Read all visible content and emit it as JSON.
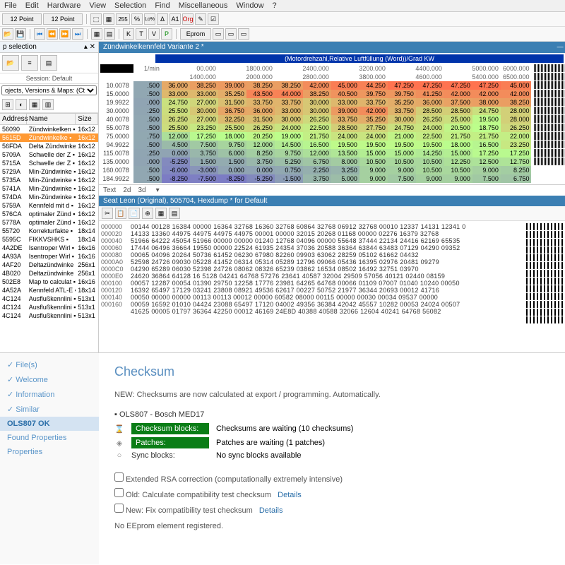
{
  "menu": [
    "File",
    "Edit",
    "Hardware",
    "View",
    "Selection",
    "Find",
    "Miscellaneous",
    "Window",
    "?"
  ],
  "toolbar_labels": {
    "font1": "12 Point",
    "font2": "12 Point",
    "eprom": "Eprom"
  },
  "sidebar": {
    "title": "p selection",
    "session": "Session: Default",
    "dropdown": "ojects, Versions & Maps:  (Ctrl+Shift+F)",
    "cols": [
      "Address",
      "Name",
      "Size"
    ],
    "rows": [
      {
        "a": "56090",
        "n": "Zündwinkelken",
        "s": "16x12"
      },
      {
        "a": "5615D",
        "n": "Zündwinkelke",
        "s": "16x12"
      },
      {
        "a": "56FDA",
        "n": "Delta Zündwinke",
        "s": "16x12"
      },
      {
        "a": "5709A",
        "n": "Schwelle der Z",
        "s": "16x12"
      },
      {
        "a": "5715A",
        "n": "Schwelle der Z",
        "s": "16x12"
      },
      {
        "a": "5729A",
        "n": "Min-Zündwinke",
        "s": "16x12"
      },
      {
        "a": "5735A",
        "n": "Min-Zündwinke",
        "s": "16x12"
      },
      {
        "a": "5741A",
        "n": "Min-Zündwinke",
        "s": "16x12"
      },
      {
        "a": "574DA",
        "n": "Min-Zündwinke",
        "s": "16x12"
      },
      {
        "a": "5759A",
        "n": "Kennfeld mit d",
        "s": "16x12"
      },
      {
        "a": "576CA",
        "n": "optimaler Zünd",
        "s": "16x12"
      },
      {
        "a": "5778A",
        "n": "optimaler Zünd",
        "s": "16x12"
      },
      {
        "a": "55720",
        "n": "Korrekturfakte",
        "s": "18x14"
      },
      {
        "a": "5595C",
        "n": "FIKKVSHKS",
        "s": "18x14"
      },
      {
        "a": "4A2DE",
        "n": "Isentroper Wirl",
        "s": "16x16"
      },
      {
        "a": "4A93A",
        "n": "Isentroper Wirl",
        "s": "16x16"
      },
      {
        "a": "4AF20",
        "n": "Deltazündwinke",
        "s": "256x1"
      },
      {
        "a": "4B020",
        "n": "Deltazündwinke",
        "s": "256x1"
      },
      {
        "a": "502E8",
        "n": "Map to calculat",
        "s": "16x16"
      },
      {
        "a": "4A52A",
        "n": "Kennfeld ATL-E",
        "s": "18x14"
      },
      {
        "a": "4C124",
        "n": "Ausflußkennlini",
        "s": "513x1"
      },
      {
        "a": "4C124",
        "n": "Ausflußkennlini",
        "s": "513x1"
      },
      {
        "a": "4C124",
        "n": "Ausflußkennlini",
        "s": "513x1"
      }
    ],
    "selected": 1
  },
  "map": {
    "title": "Zündwinkelkennfeld Variante 2 *",
    "header": "(Motordrehzahl,Relative Luftfüllung (Word))/Grad KW",
    "unit": "1/min",
    "cols_top": [
      "00.000",
      "1800.000",
      "2400.000",
      "3200.000",
      "4400.000",
      "5000.000",
      "6000.000"
    ],
    "cols_bot": [
      "1400.000",
      "2000.000",
      "2800.000",
      "3800.000",
      "4600.000",
      "5400.000",
      "6500.000"
    ],
    "rows": [
      {
        "h": "10.0078",
        "v": [
          ".500",
          "36.000",
          "38.250",
          "39.000",
          "38.250",
          "38.250",
          "42.000",
          "45.000",
          "44.250",
          "47.250",
          "47.250",
          "47.250",
          "47.250",
          "45.000"
        ]
      },
      {
        "h": "15.0000",
        "v": [
          ".500",
          "33.000",
          "33.000",
          "35.250",
          "43.500",
          "44.000",
          "38.250",
          "40.500",
          "39.750",
          "39.750",
          "41.250",
          "42.000",
          "42.000",
          "42.000"
        ]
      },
      {
        "h": "19.9922",
        "v": [
          ".000",
          "24.750",
          "27.000",
          "31.500",
          "33.750",
          "33.750",
          "30.000",
          "33.000",
          "33.750",
          "35.250",
          "36.000",
          "37.500",
          "38.000",
          "38.250"
        ]
      },
      {
        "h": "30.0000",
        "v": [
          ".250",
          "25.500",
          "30.000",
          "36.750",
          "36.000",
          "33.000",
          "30.000",
          "39.000",
          "42.000",
          "33.750",
          "28.500",
          "28.500",
          "24.750",
          "28.000"
        ]
      },
      {
        "h": "40.0078",
        "v": [
          ".500",
          "26.250",
          "27.000",
          "32.250",
          "31.500",
          "30.000",
          "26.250",
          "33.750",
          "35.250",
          "30.000",
          "26.250",
          "25.000",
          "19.500",
          "28.000"
        ]
      },
      {
        "h": "55.0078",
        "v": [
          ".500",
          "25.500",
          "23.250",
          "25.500",
          "26.250",
          "24.000",
          "22.500",
          "28.500",
          "27.750",
          "24.750",
          "24.000",
          "20.500",
          "18.750",
          "26.250"
        ]
      },
      {
        "h": "75.0000",
        "v": [
          ".750",
          "12.000",
          "17.250",
          "18.000",
          "20.250",
          "19.000",
          "21.750",
          "24.000",
          "24.000",
          "21.000",
          "22.500",
          "21.750",
          "21.750",
          "22.000"
        ]
      },
      {
        "h": "94.9922",
        "v": [
          ".500",
          "4.500",
          "7.500",
          "9.750",
          "12.000",
          "14.500",
          "16.500",
          "19.500",
          "19.500",
          "19.500",
          "19.500",
          "18.000",
          "16.500",
          "23.250"
        ]
      },
      {
        "h": "115.0078",
        "v": [
          ".250",
          "0.000",
          "3.750",
          "6.000",
          "8.250",
          "9.750",
          "12.000",
          "13.500",
          "15.000",
          "15.000",
          "14.250",
          "15.000",
          "17.250",
          "17.250"
        ]
      },
      {
        "h": "135.0000",
        "v": [
          ".000",
          "-5.250",
          "1.500",
          "1.500",
          "3.750",
          "5.250",
          "6.750",
          "8.000",
          "10.500",
          "10.500",
          "10.500",
          "12.250",
          "12.500",
          "12.750"
        ]
      },
      {
        "h": "160.0078",
        "v": [
          ".500",
          "-6.000",
          "-3.000",
          "0.000",
          "0.000",
          "0.750",
          "2.250",
          "3.250",
          "9.000",
          "9.000",
          "10.500",
          "10.500",
          "9.000",
          "8.250"
        ]
      },
      {
        "h": "184.9922",
        "v": [
          ".500",
          "-8.250",
          "-7.500",
          "-8.250",
          "-5.250",
          "-1.500",
          "3.750",
          "5.000",
          "9.000",
          "7.500",
          "9.000",
          "9.000",
          "7.500",
          "6.750"
        ]
      }
    ],
    "tabs": [
      "Text",
      "2d",
      "3d"
    ]
  },
  "hex": {
    "title": "Seat Leon (Original), 505704, Hexdump * for Default",
    "offsets": [
      "000000",
      "000020",
      "000040",
      "000060",
      "000080",
      "0000A0",
      "0000C0",
      "0000E0",
      "000100",
      "000120",
      "000140",
      "000160"
    ],
    "lines": [
      "00144 00128 16384 00000 16364 32768 16360 32768 60864 32768 06912 32768 00010 12337 14131 12341 0",
      "14133 13360 44975 44975 44975 44975 00001 00000 32015 20268 01168 00000 02276 16379 32768",
      "51966 64222 45054 51966 00000 00000 01240 12768 04096 00000 55648 37444 22134 24416 62169 65535",
      "17444 06496 36664 19550 00000 22524 61935 24354 37036 20588 36364 63844 63483 07129 04290 09352",
      "00065 04096 20264 50736 61452 06230 67980 82260 09903 63062 28259 05102 61662 04432",
      "52598 24726 09030 05228 41452 06314 05314 05289 12796 09066 05436 16395 02976 20481 09279",
      "04290 65289 06030 52398 24726 08062 08326 65239 03862 16534 08502 16492 32751 03970",
      "24620 36864 64128 16 5128 04241 64768 57276 23641 40587 32004 29509 57056 40121 02440 08159",
      "00057 12287 00054 01390 29750 12258 17776 23981 64265 64768 00066 01109 07007 01040 10240 00050",
      "16392 65497 17129 03241 23808 08921 49536 62617 00227 50752 21977 36344 20693 00012 41716",
      "00050 00000 00000 00113 00113 00012 00000 60582 08000 00115 00000 00030 00034 09537 00000",
      "00059 16592 01010 04424 23088 65497 17120 04002 49356 36384 42042 45557 10282 00053 24024 00507",
      "41625 00005 01797 36364 42250 00012 46169 24E8D 40388 40588 32066 12604 40241 64768 56082"
    ]
  },
  "nav": [
    {
      "label": "File(s)",
      "chk": true
    },
    {
      "label": "Welcome",
      "chk": true
    },
    {
      "label": "Information",
      "chk": true
    },
    {
      "label": "Similar",
      "chk": true
    },
    {
      "label": "OLS807 OK",
      "sel": true
    },
    {
      "label": "Found Properties"
    },
    {
      "label": "Properties"
    }
  ],
  "checksum": {
    "title": "Checksum",
    "new": "NEW: Checksums are now calculated at export / programming. Automatically.",
    "box": "OLS807 - Bosch MED17",
    "rows": [
      {
        "ic": "⌛",
        "label": "Checksum blocks:",
        "txt": "Checksums are waiting (10 checksums)",
        "pill": true
      },
      {
        "ic": "◈",
        "label": "Patches:",
        "txt": "Patches are waiting (1 patches)",
        "pill": true
      },
      {
        "ic": "○",
        "label": "Sync blocks:",
        "txt": "No sync blocks available",
        "pill": false
      }
    ],
    "opts": [
      "Extended RSA correction (computationally extremely intensive)",
      "Old: Calculate compatibility test checksum",
      "New: Fix compatibility test checksum"
    ],
    "details": "Details",
    "footer": "No EEprom element registered."
  },
  "chart_data": {
    "type": "heatmap",
    "title": "Zündwinkelkennfeld Variante 2",
    "xlabel": "Motordrehzahl 1/min",
    "ylabel": "Relative Luftfüllung (Word)",
    "zlabel": "Grad KW",
    "x": [
      0,
      1400,
      1800,
      2000,
      2400,
      2800,
      3200,
      3800,
      4400,
      4600,
      5000,
      5400,
      6000,
      6500
    ],
    "y": [
      10.0078,
      15.0,
      19.9922,
      30.0,
      40.0078,
      55.0078,
      75.0,
      94.9922,
      115.0078,
      135.0,
      160.0078,
      184.9922
    ],
    "z": [
      [
        0.5,
        36.0,
        38.25,
        39.0,
        38.25,
        38.25,
        42.0,
        45.0,
        44.25,
        47.25,
        47.25,
        47.25,
        47.25,
        45.0
      ],
      [
        0.5,
        33.0,
        33.0,
        35.25,
        43.5,
        44.0,
        38.25,
        40.5,
        39.75,
        39.75,
        41.25,
        42.0,
        42.0,
        42.0
      ],
      [
        0.0,
        24.75,
        27.0,
        31.5,
        33.75,
        33.75,
        30.0,
        33.0,
        33.75,
        35.25,
        36.0,
        37.5,
        38.0,
        38.25
      ],
      [
        0.25,
        25.5,
        30.0,
        36.75,
        36.0,
        33.0,
        30.0,
        39.0,
        42.0,
        33.75,
        28.5,
        28.5,
        24.75,
        28.0
      ],
      [
        0.5,
        26.25,
        27.0,
        32.25,
        31.5,
        30.0,
        26.25,
        33.75,
        35.25,
        30.0,
        26.25,
        25.0,
        19.5,
        28.0
      ],
      [
        0.5,
        25.5,
        23.25,
        25.5,
        26.25,
        24.0,
        22.5,
        28.5,
        27.75,
        24.75,
        24.0,
        20.5,
        18.75,
        26.25
      ],
      [
        0.75,
        12.0,
        17.25,
        18.0,
        20.25,
        19.0,
        21.75,
        24.0,
        24.0,
        21.0,
        22.5,
        21.75,
        21.75,
        22.0
      ],
      [
        0.5,
        4.5,
        7.5,
        9.75,
        12.0,
        14.5,
        16.5,
        19.5,
        19.5,
        19.5,
        19.5,
        18.0,
        16.5,
        23.25
      ],
      [
        0.25,
        0.0,
        3.75,
        6.0,
        8.25,
        9.75,
        12.0,
        13.5,
        15.0,
        15.0,
        14.25,
        15.0,
        17.25,
        17.25
      ],
      [
        0.0,
        -5.25,
        1.5,
        1.5,
        3.75,
        5.25,
        6.75,
        8.0,
        10.5,
        10.5,
        10.5,
        12.25,
        12.5,
        12.75
      ],
      [
        0.5,
        -6.0,
        -3.0,
        0.0,
        0.0,
        0.75,
        2.25,
        3.25,
        9.0,
        9.0,
        10.5,
        10.5,
        9.0,
        8.25
      ],
      [
        0.5,
        -8.25,
        -7.5,
        -8.25,
        -5.25,
        -1.5,
        3.75,
        5.0,
        9.0,
        7.5,
        9.0,
        9.0,
        7.5,
        6.75
      ]
    ]
  }
}
